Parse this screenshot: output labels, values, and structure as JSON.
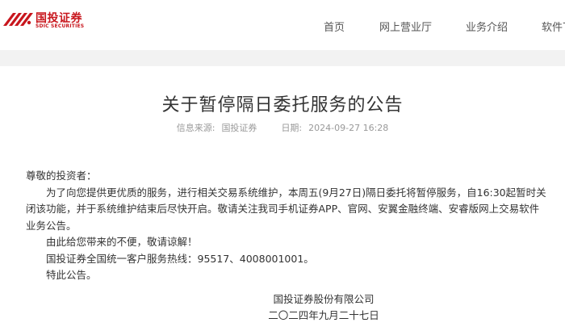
{
  "header": {
    "logo": {
      "name_cn": "国投证券",
      "name_en": "SDIC SECURITIES",
      "brand_color": "#c8161d"
    },
    "nav": [
      {
        "label": "首页"
      },
      {
        "label": "网上营业厅"
      },
      {
        "label": "业务介绍"
      },
      {
        "label": "软件下"
      }
    ]
  },
  "article": {
    "title": "关于暂停隔日委托服务的公告",
    "source_label": "信息来源:",
    "source_value": "国投证券",
    "date_label": "日期:",
    "date_value": "2024-09-27 16:28",
    "salutation": "尊敬的投资者：",
    "para1": "为了向您提供更优质的服务，进行相关交易系统维护，本周五(9月27日)隔日委托将暂停服务，自16:30起暂时关闭该功能，并于系统维护结束后尽快开启。敬请关注我司手机证券APP、官网、安翼金融终端、安睿版网上交易软件业务公告。",
    "para2": "由此给您带来的不便，敬请谅解！",
    "para3": "国投证券全国统一客户服务热线：95517、4008001001。",
    "para4": "特此公告。",
    "signature_company": "国投证券股份有限公司",
    "signature_date": "二〇二四年九月二十七日"
  }
}
